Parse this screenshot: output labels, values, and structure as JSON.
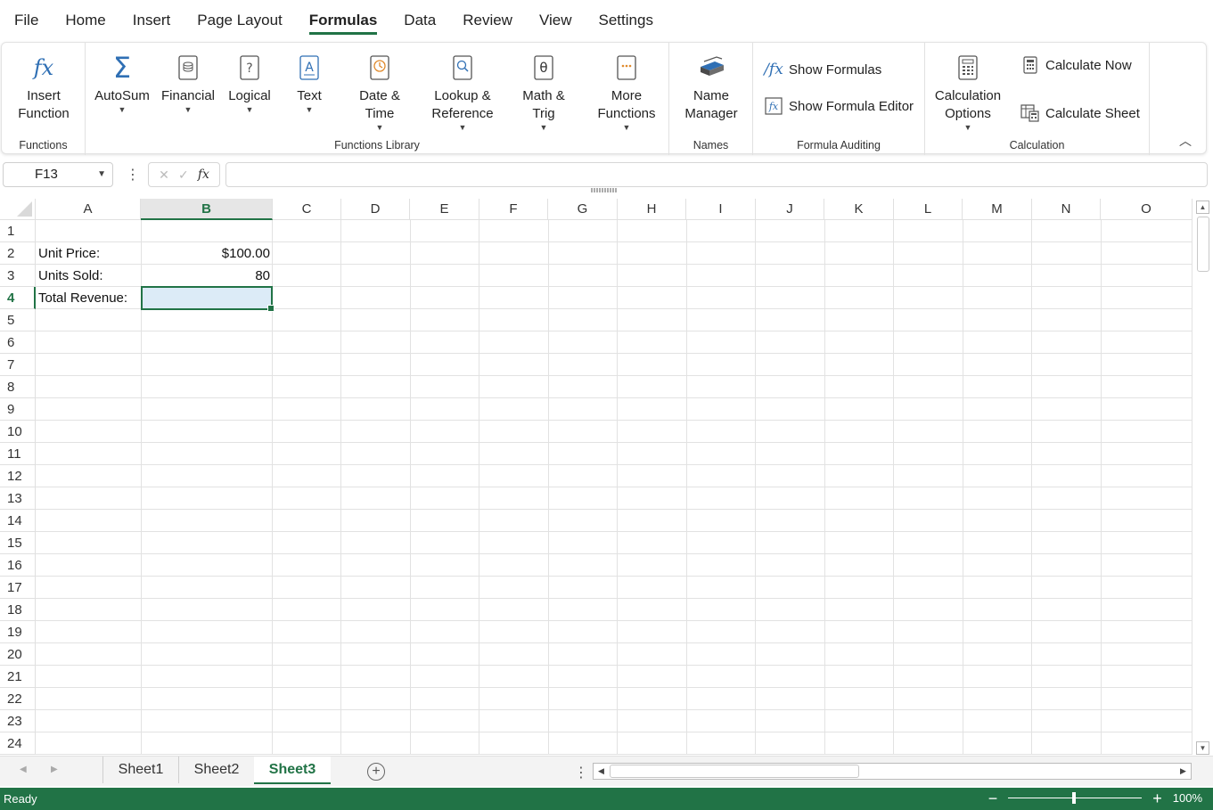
{
  "menu": {
    "items": [
      {
        "label": "File"
      },
      {
        "label": "Home"
      },
      {
        "label": "Insert"
      },
      {
        "label": "Page Layout"
      },
      {
        "label": "Formulas"
      },
      {
        "label": "Data"
      },
      {
        "label": "Review"
      },
      {
        "label": "View"
      },
      {
        "label": "Settings"
      }
    ],
    "active": "Formulas"
  },
  "ribbon": {
    "functions": {
      "insert_function_l1": "Insert",
      "insert_function_l2": "Function",
      "group_label": "Functions"
    },
    "library": {
      "autosum": "AutoSum",
      "financial": "Financial",
      "logical": "Logical",
      "text": "Text",
      "datetime_l1": "Date &",
      "datetime_l2": "Time",
      "lookup_l1": "Lookup &",
      "lookup_l2": "Reference",
      "math_l1": "Math &",
      "math_l2": "Trig",
      "more_l1": "More",
      "more_l2": "Functions",
      "group_label": "Functions Library"
    },
    "names": {
      "name_manager_l1": "Name",
      "name_manager_l2": "Manager",
      "group_label": "Names"
    },
    "auditing": {
      "show_formulas": "Show Formulas",
      "show_formula_editor": "Show Formula Editor",
      "group_label": "Formula Auditing"
    },
    "calculation": {
      "options_l1": "Calculation",
      "options_l2": "Options",
      "calculate_now": "Calculate Now",
      "calculate_sheet": "Calculate Sheet",
      "group_label": "Calculation"
    }
  },
  "formula_bar": {
    "name_box": "F13",
    "formula": "",
    "fx_label": "fx"
  },
  "grid": {
    "columns": [
      "A",
      "B",
      "C",
      "D",
      "E",
      "F",
      "G",
      "H",
      "I",
      "J",
      "K",
      "L",
      "M",
      "N",
      "O"
    ],
    "selected_column": "B",
    "rows": [
      "1",
      "2",
      "3",
      "4",
      "5",
      "6",
      "7",
      "8",
      "9",
      "10",
      "11",
      "12",
      "13",
      "14",
      "15",
      "16",
      "17",
      "18",
      "19",
      "20",
      "21",
      "22",
      "23",
      "24"
    ],
    "selected_row": "4",
    "cells": {
      "A2": "Unit Price:",
      "B2": "$100.00",
      "A3": "Units Sold:",
      "B3": "80",
      "A4": "Total Revenue:",
      "B4": ""
    }
  },
  "sheets": {
    "tabs": [
      "Sheet1",
      "Sheet2",
      "Sheet3"
    ],
    "active": "Sheet3"
  },
  "status": {
    "text": "Ready",
    "zoom": "100%",
    "zoom_level": 1.0
  },
  "colors": {
    "accent": "#217346",
    "icon_blue": "#2f6fb4",
    "selection_fill": "#dcebf7"
  }
}
